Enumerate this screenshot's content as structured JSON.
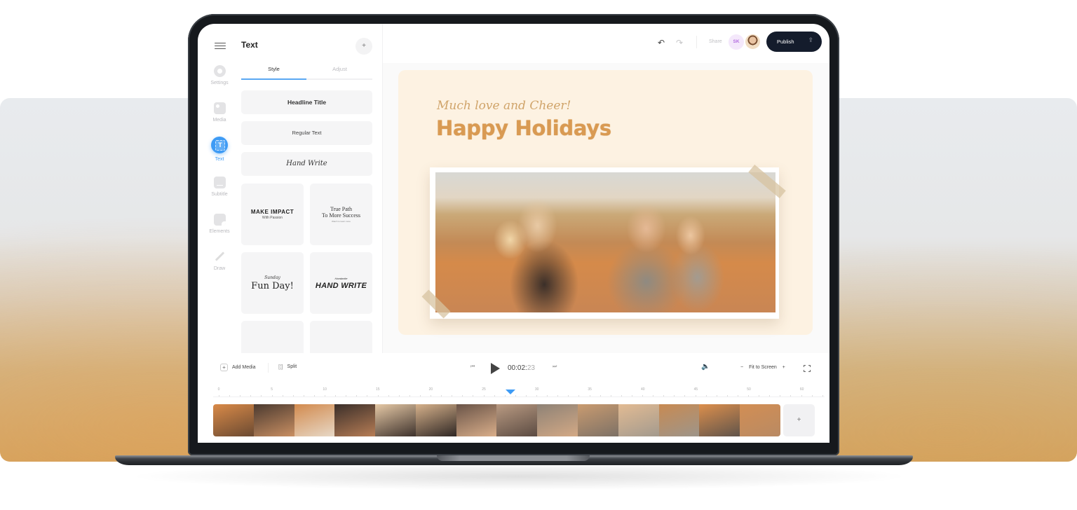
{
  "sidebar": {
    "items": [
      {
        "label": "Settings",
        "icon": "gear-icon"
      },
      {
        "label": "Media",
        "icon": "image-icon"
      },
      {
        "label": "Text",
        "icon": "text-icon",
        "active": true
      },
      {
        "label": "Subtitle",
        "icon": "subtitle-icon"
      },
      {
        "label": "Elements",
        "icon": "sticker-icon"
      },
      {
        "label": "Draw",
        "icon": "pencil-icon"
      }
    ]
  },
  "panel": {
    "title": "Text",
    "add_label": "+",
    "tabs": [
      {
        "label": "Style",
        "active": true
      },
      {
        "label": "Adjust"
      }
    ],
    "presets": {
      "headline": "Headline Title",
      "regular": "Regular Text",
      "handwrite": "Hand Write"
    },
    "tiles": [
      {
        "line1": "MAKE IMPACT",
        "line2": "With Passion"
      },
      {
        "line1": "True Path",
        "line1b": "To More Success",
        "line2": "Watch to learn more"
      },
      {
        "line1": "Sunday",
        "line2": "Fun Day!"
      },
      {
        "line1": "Handwrite",
        "line2": "HAND WRITE"
      }
    ]
  },
  "topbar": {
    "undo_icon": "↶",
    "redo_icon": "↷",
    "share_label": "Share",
    "avatar_initials": "SK",
    "publish_label": "Publish",
    "publish_icon": "⇪"
  },
  "canvas": {
    "script_text": "Much love and Cheer!",
    "headline_text": "Happy Holidays",
    "background_color": "#fdf2e2",
    "accent_color": "#d99a52"
  },
  "playbar": {
    "add_media_label": "Add Media",
    "add_media_icon": "+",
    "split_label": "Split",
    "split_icon": "[¦]",
    "skip_back_icon": "⏮",
    "skip_fwd_icon": "⏭",
    "time_main": "00:02:",
    "time_frames": "23",
    "volume_icon": "🔈",
    "zoom_minus": "−",
    "zoom_label": "Fit to Screen",
    "zoom_plus": "+",
    "ruler_labels": [
      "0",
      "5",
      "10",
      "15",
      "20",
      "25",
      "30",
      "35",
      "40",
      "45",
      "50",
      "60"
    ],
    "playhead_position_seconds": 27.5,
    "add_clip_label": "+",
    "accent_color": "#3e9bf5"
  }
}
